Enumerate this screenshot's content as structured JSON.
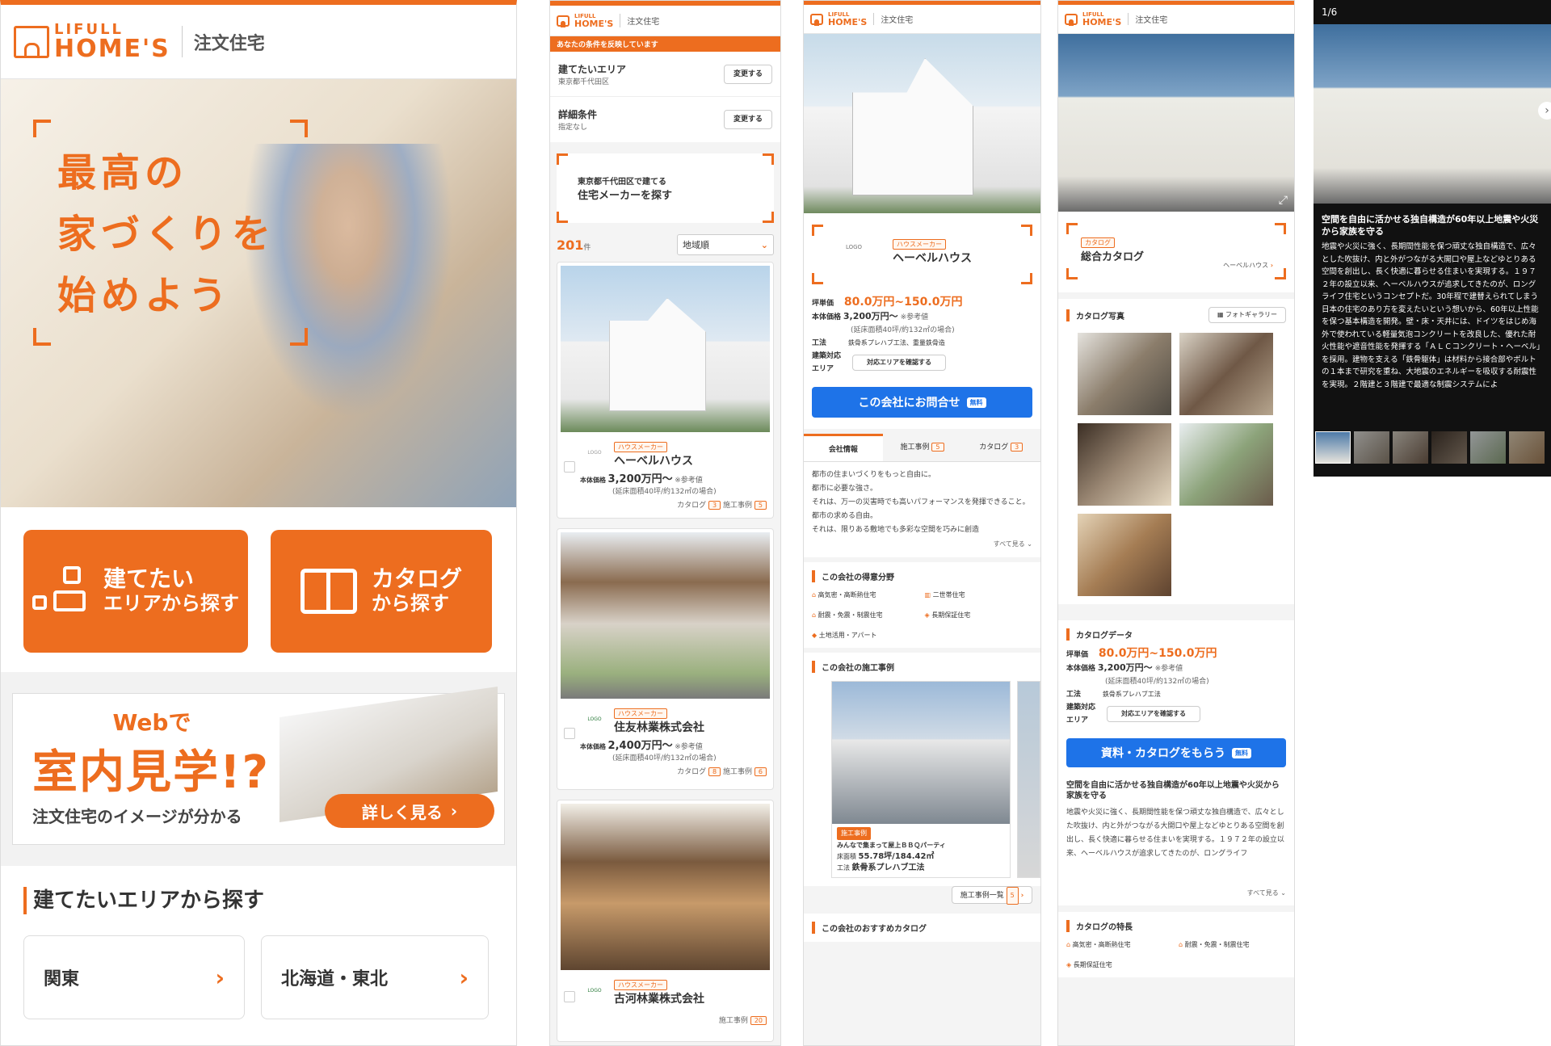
{
  "brand": {
    "logo_top": "LIFULL",
    "logo_bottom": "HOME'S",
    "service": "注文住宅"
  },
  "s1": {
    "hero_lines": [
      "最高の",
      "家づくりを",
      "始めよう"
    ],
    "btn_area": {
      "l1": "建てたい",
      "l2": "エリアから探す"
    },
    "btn_catalog": {
      "l1": "カタログ",
      "l2": "から探す"
    },
    "banner": {
      "top": "Webで",
      "main": "室内見学!?",
      "sub": "注文住宅のイメージが分かる",
      "cta": "詳しく見る"
    },
    "section_title": "建てたいエリアから探す",
    "regions": [
      "関東",
      "北海道・東北"
    ]
  },
  "s2": {
    "notice": "あなたの条件を反映しています",
    "cond_area_label": "建てたいエリア",
    "cond_area_value": "東京都千代田区",
    "change": "変更する",
    "cond_detail_label": "詳細条件",
    "cond_detail_value": "指定なし",
    "search_l1": "東京都千代田区で建てる",
    "search_l2": "住宅メーカーを探す",
    "count": "201",
    "count_unit": "件",
    "sort": "地域順",
    "price_label": "本体価格",
    "ref": "※参考値",
    "area_note": "(延床面積40坪/約132㎡の場合)",
    "tag": "ハウスメーカー",
    "catalog": "カタログ",
    "cases": "施工事例",
    "items": [
      {
        "name": "ヘーベルハウス",
        "price": "3,200万円〜",
        "cat": "3",
        "cases": "5"
      },
      {
        "name": "住友林業株式会社",
        "price": "2,400万円〜",
        "cat": "8",
        "cases": "6"
      },
      {
        "name": "古河林業株式会社",
        "cases": "20"
      }
    ]
  },
  "s3": {
    "tag": "ハウスメーカー",
    "name": "ヘーベルハウス",
    "tsubo_label": "坪単価",
    "tsubo": "80.0万円~150.0万円",
    "price_label": "本体価格",
    "price": "3,200万円〜",
    "ref": "※参考値",
    "area_note": "(延床面積40坪/約132㎡の場合)",
    "method_label": "工法",
    "method": "鉄骨系プレハブ工法、重量鉄骨造",
    "area_label": "建築対応エリア",
    "area_btn": "対応エリアを確認する",
    "cta": "この会社にお問合せ",
    "free": "無料",
    "tabs": [
      {
        "label": "会社情報"
      },
      {
        "label": "施工事例",
        "n": "5"
      },
      {
        "label": "カタログ",
        "n": "3"
      }
    ],
    "desc": [
      "都市の住まいづくりをもっと自由に。",
      "都市に必要な強さ。",
      "それは、万一の災害時でも高いパフォーマンスを発揮できること。",
      "都市の求める自由。",
      "それは、限りある敷地でも多彩な空間を巧みに創造"
    ],
    "more": "すべて見る",
    "strengths_title": "この会社の得意分野",
    "strengths": [
      "高気密・高断熱住宅",
      "二世帯住宅",
      "耐震・免震・制震住宅",
      "長期保証住宅",
      "土地活用・アパート"
    ],
    "cases_title": "この会社の施工事例",
    "case": {
      "tag": "施工事例",
      "title": "みんなで集まって屋上ＢＢＱパーティ",
      "floor_label": "床面積",
      "floor": "55.78坪/184.42㎡",
      "method_label": "工法",
      "method": "鉄骨系プレハブ工法"
    },
    "case_list": "施工事例一覧",
    "case_n": "5",
    "rec_title": "この会社のおすすめカタログ"
  },
  "s4": {
    "tag": "カタログ",
    "title": "総合カタログ",
    "maker": "ヘーベルハウス",
    "photos_title": "カタログ写真",
    "gallery": "フォトギャラリー",
    "data_title": "カタログデータ",
    "tsubo_label": "坪単価",
    "tsubo": "80.0万円~150.0万円",
    "price_label": "本体価格",
    "price": "3,200万円〜",
    "ref": "※参考値",
    "area_note": "(延床面積40坪/約132㎡の場合)",
    "method_label": "工法",
    "method": "鉄骨系プレハブ工法",
    "area_label": "建築対応エリア",
    "area_btn": "対応エリアを確認する",
    "cta": "資料・カタログをもらう",
    "free": "無料",
    "headline": "空間を自由に活かせる独自構造が60年以上地震や火災から家族を守る",
    "body": "地震や火災に強く、長期間性能を保つ頑丈な独自構造で、広々とした吹抜け、内と外がつながる大開口や屋上などゆとりある空間を創出し、長く快適に暮らせる住まいを実現する。１９７２年の設立以来、ヘーベルハウスが追求してきたのが、ロングライフ",
    "more": "すべて見る",
    "features_title": "カタログの特長",
    "features": [
      "高気密・高断熱住宅",
      "耐震・免震・制震住宅",
      "長期保証住宅"
    ]
  },
  "s5": {
    "counter": "1/6",
    "headline": "空間を自由に活かせる独自構造が60年以上地震や火災から家族を守る",
    "body": "地震や火災に強く、長期間性能を保つ頑丈な独自構造で、広々とした吹抜け、内と外がつながる大開口や屋上などゆとりある空間を創出し、長く快適に暮らせる住まいを実現する。１９７２年の設立以来、ヘーベルハウスが追求してきたのが、ロングライフ住宅というコンセプトだ。30年程で建替えられてしまう日本の住宅のあり方を変えたいという想いから、60年以上性能を保つ基本構造を開発。壁・床・天井には、ドイツをはじめ海外で使われている軽量気泡コンクリートを改良した、優れた耐火性能や遮音性能を発揮する「ＡＬＣコンクリート・ヘーベル」を採用。建物を支える「鉄骨躯体」は材料から接合部やボルトの１本まで研究を重ね、大地震のエネルギーを吸収する耐震性を実現。２階建と３階建で最適な制震システムによ"
  }
}
